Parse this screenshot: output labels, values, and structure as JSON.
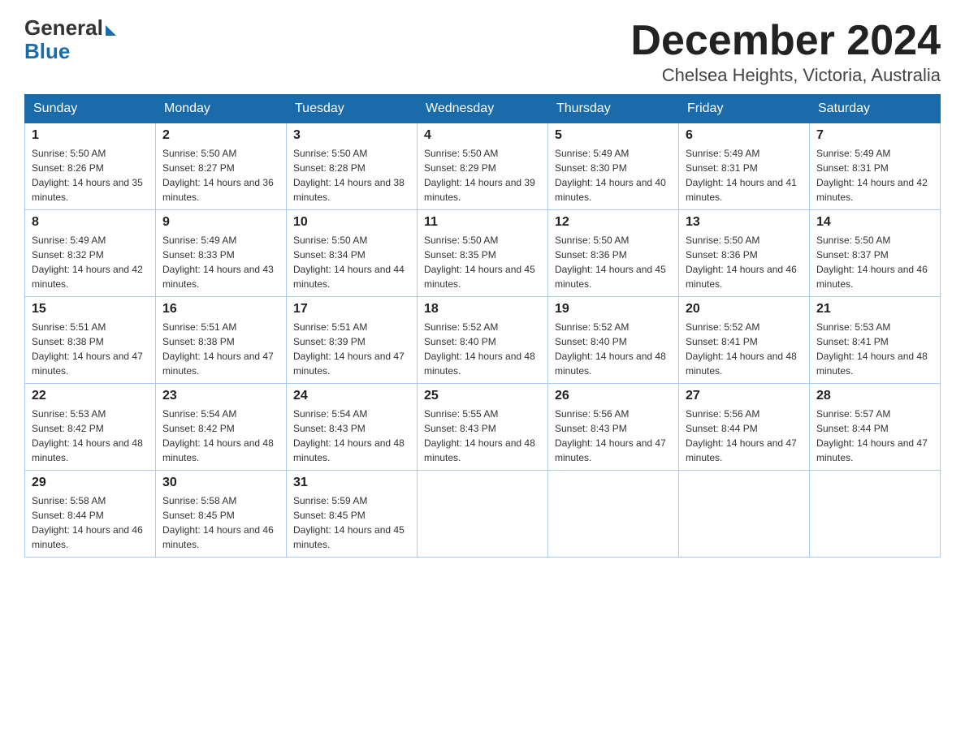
{
  "header": {
    "logo_line1": "General",
    "logo_line2": "Blue",
    "month_title": "December 2024",
    "location": "Chelsea Heights, Victoria, Australia"
  },
  "days_of_week": [
    "Sunday",
    "Monday",
    "Tuesday",
    "Wednesday",
    "Thursday",
    "Friday",
    "Saturday"
  ],
  "weeks": [
    [
      {
        "day": "1",
        "sunrise": "5:50 AM",
        "sunset": "8:26 PM",
        "daylight": "14 hours and 35 minutes."
      },
      {
        "day": "2",
        "sunrise": "5:50 AM",
        "sunset": "8:27 PM",
        "daylight": "14 hours and 36 minutes."
      },
      {
        "day": "3",
        "sunrise": "5:50 AM",
        "sunset": "8:28 PM",
        "daylight": "14 hours and 38 minutes."
      },
      {
        "day": "4",
        "sunrise": "5:50 AM",
        "sunset": "8:29 PM",
        "daylight": "14 hours and 39 minutes."
      },
      {
        "day": "5",
        "sunrise": "5:49 AM",
        "sunset": "8:30 PM",
        "daylight": "14 hours and 40 minutes."
      },
      {
        "day": "6",
        "sunrise": "5:49 AM",
        "sunset": "8:31 PM",
        "daylight": "14 hours and 41 minutes."
      },
      {
        "day": "7",
        "sunrise": "5:49 AM",
        "sunset": "8:31 PM",
        "daylight": "14 hours and 42 minutes."
      }
    ],
    [
      {
        "day": "8",
        "sunrise": "5:49 AM",
        "sunset": "8:32 PM",
        "daylight": "14 hours and 42 minutes."
      },
      {
        "day": "9",
        "sunrise": "5:49 AM",
        "sunset": "8:33 PM",
        "daylight": "14 hours and 43 minutes."
      },
      {
        "day": "10",
        "sunrise": "5:50 AM",
        "sunset": "8:34 PM",
        "daylight": "14 hours and 44 minutes."
      },
      {
        "day": "11",
        "sunrise": "5:50 AM",
        "sunset": "8:35 PM",
        "daylight": "14 hours and 45 minutes."
      },
      {
        "day": "12",
        "sunrise": "5:50 AM",
        "sunset": "8:36 PM",
        "daylight": "14 hours and 45 minutes."
      },
      {
        "day": "13",
        "sunrise": "5:50 AM",
        "sunset": "8:36 PM",
        "daylight": "14 hours and 46 minutes."
      },
      {
        "day": "14",
        "sunrise": "5:50 AM",
        "sunset": "8:37 PM",
        "daylight": "14 hours and 46 minutes."
      }
    ],
    [
      {
        "day": "15",
        "sunrise": "5:51 AM",
        "sunset": "8:38 PM",
        "daylight": "14 hours and 47 minutes."
      },
      {
        "day": "16",
        "sunrise": "5:51 AM",
        "sunset": "8:38 PM",
        "daylight": "14 hours and 47 minutes."
      },
      {
        "day": "17",
        "sunrise": "5:51 AM",
        "sunset": "8:39 PM",
        "daylight": "14 hours and 47 minutes."
      },
      {
        "day": "18",
        "sunrise": "5:52 AM",
        "sunset": "8:40 PM",
        "daylight": "14 hours and 48 minutes."
      },
      {
        "day": "19",
        "sunrise": "5:52 AM",
        "sunset": "8:40 PM",
        "daylight": "14 hours and 48 minutes."
      },
      {
        "day": "20",
        "sunrise": "5:52 AM",
        "sunset": "8:41 PM",
        "daylight": "14 hours and 48 minutes."
      },
      {
        "day": "21",
        "sunrise": "5:53 AM",
        "sunset": "8:41 PM",
        "daylight": "14 hours and 48 minutes."
      }
    ],
    [
      {
        "day": "22",
        "sunrise": "5:53 AM",
        "sunset": "8:42 PM",
        "daylight": "14 hours and 48 minutes."
      },
      {
        "day": "23",
        "sunrise": "5:54 AM",
        "sunset": "8:42 PM",
        "daylight": "14 hours and 48 minutes."
      },
      {
        "day": "24",
        "sunrise": "5:54 AM",
        "sunset": "8:43 PM",
        "daylight": "14 hours and 48 minutes."
      },
      {
        "day": "25",
        "sunrise": "5:55 AM",
        "sunset": "8:43 PM",
        "daylight": "14 hours and 48 minutes."
      },
      {
        "day": "26",
        "sunrise": "5:56 AM",
        "sunset": "8:43 PM",
        "daylight": "14 hours and 47 minutes."
      },
      {
        "day": "27",
        "sunrise": "5:56 AM",
        "sunset": "8:44 PM",
        "daylight": "14 hours and 47 minutes."
      },
      {
        "day": "28",
        "sunrise": "5:57 AM",
        "sunset": "8:44 PM",
        "daylight": "14 hours and 47 minutes."
      }
    ],
    [
      {
        "day": "29",
        "sunrise": "5:58 AM",
        "sunset": "8:44 PM",
        "daylight": "14 hours and 46 minutes."
      },
      {
        "day": "30",
        "sunrise": "5:58 AM",
        "sunset": "8:45 PM",
        "daylight": "14 hours and 46 minutes."
      },
      {
        "day": "31",
        "sunrise": "5:59 AM",
        "sunset": "8:45 PM",
        "daylight": "14 hours and 45 minutes."
      },
      null,
      null,
      null,
      null
    ]
  ],
  "labels": {
    "sunrise": "Sunrise:",
    "sunset": "Sunset:",
    "daylight": "Daylight:"
  }
}
